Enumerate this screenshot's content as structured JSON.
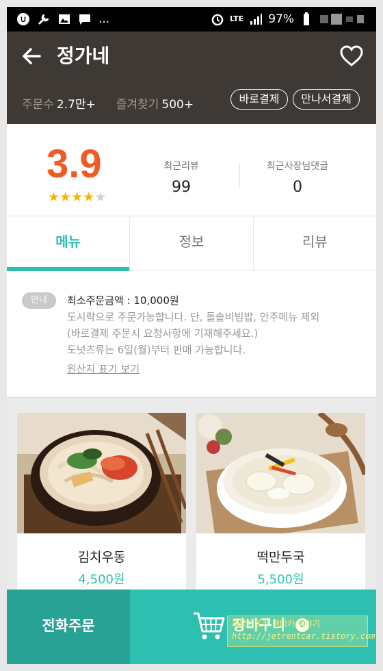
{
  "status_bar": {
    "left_icons": [
      "app-u-icon",
      "wrench-icon",
      "image-icon",
      "chat-icon"
    ],
    "more": "...",
    "network": "LTE",
    "battery": "97%"
  },
  "header": {
    "title": "정가네",
    "order_count_label": "주문수",
    "order_count_value": "2.7만+",
    "favorite_label": "즐겨찾기",
    "favorite_value": "500+",
    "pay_direct_label": "바로결제",
    "pay_meet_label": "만나서결제"
  },
  "rating": {
    "score": "3.9",
    "stars_filled": 4,
    "stars_total": 5,
    "recent_reviews_label": "최근리뷰",
    "recent_reviews_value": "99",
    "owner_replies_label": "최근사장님댓글",
    "owner_replies_value": "0"
  },
  "tabs": [
    {
      "label": "메뉴",
      "active": true
    },
    {
      "label": "정보",
      "active": false
    },
    {
      "label": "리뷰",
      "active": false
    }
  ],
  "notice": {
    "badge": "안내",
    "lines": [
      "최소주문금액 : 10,000원",
      "도시락으로 주문가능합니다. 단, 돌솥비빔밥, 안주메뉴 제외",
      "(바로결제 주문시 요청사항에 기재해주세요.)",
      "도넛츠류는 6일(월)부터 판매 가능합니다."
    ],
    "origin_link": "원산지 표기 보기"
  },
  "menu_items": [
    {
      "name": "김치우동",
      "price": "4,500원"
    },
    {
      "name": "떡만두국",
      "price": "5,500원"
    }
  ],
  "bottom_bar": {
    "phone_order": "전화주문",
    "cart_label": "장바구니",
    "cart_count": "0"
  },
  "watermark": {
    "line1": "제트렌트카 렌터카 이야기",
    "line2": "http://jetrentcar.tistory.com"
  },
  "colors": {
    "accent": "#2bbfb1",
    "header_bg": "#3e3934",
    "score": "#f05a23",
    "star": "#f5b400"
  }
}
